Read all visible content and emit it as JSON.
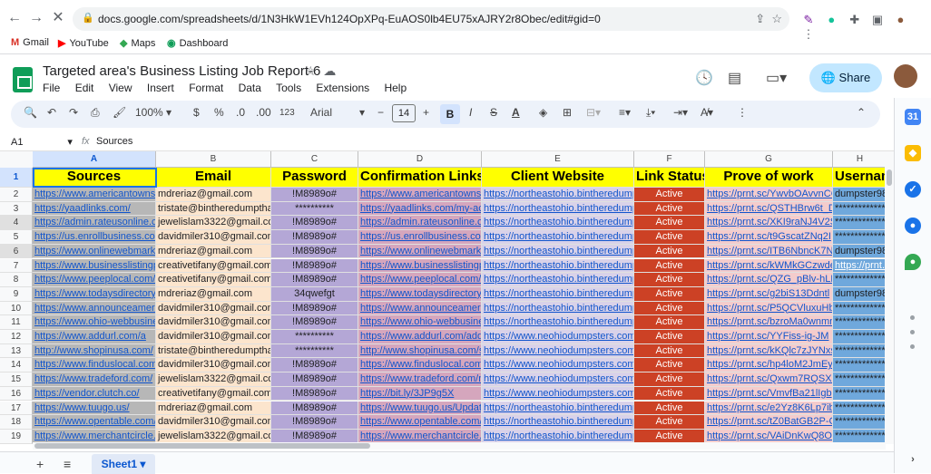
{
  "browser": {
    "url": "docs.google.com/spreadsheets/d/1N3HkW1EVh124OpXPq-EuAOS0lb4EU75xAJRY2r8Obec/edit#gid=0",
    "bookmarks": [
      {
        "label": "Gmail",
        "icon": "gmail-icon",
        "color": "#d93025"
      },
      {
        "label": "YouTube",
        "icon": "youtube-icon",
        "color": "#ff0000"
      },
      {
        "label": "Maps",
        "icon": "maps-icon",
        "color": "#34a853"
      },
      {
        "label": "Dashboard",
        "icon": "dashboard-icon",
        "color": "#0f9d58"
      }
    ]
  },
  "app": {
    "title": "Targeted area's Business Listing Job Report-6",
    "menus": [
      "File",
      "Edit",
      "View",
      "Insert",
      "Format",
      "Data",
      "Tools",
      "Extensions",
      "Help"
    ],
    "share_label": "Share"
  },
  "toolbar": {
    "zoom": "100%",
    "currency": "$",
    "percent": "%",
    "dec_decrease": ".0",
    "dec_increase": ".00",
    "number_format": "123",
    "font": "Arial",
    "font_size": "14",
    "bold": "B",
    "italic": "I",
    "strike": "S",
    "text_color": "A"
  },
  "formula": {
    "cell_ref": "A1",
    "fx": "fx",
    "content": "Sources"
  },
  "columns": [
    "A",
    "B",
    "C",
    "D",
    "E",
    "F",
    "G",
    "H"
  ],
  "headers": [
    "Sources",
    "Email",
    "Password",
    "Confirmation Links",
    "Client Website",
    "Link Status",
    "Prove of work",
    "Usernam"
  ],
  "rows": [
    [
      "https://www.americantowns.com",
      "mdreriaz@gmail.com",
      "!M8989o#",
      "https://www.americantowns.com",
      "https://northeastohio.bintheredumpthat.com",
      "Active",
      "https://prnt.sc/YwvbOAvvnCC",
      "dumpster98"
    ],
    [
      "https://yaadlinks.com/",
      "tristate@bintheredumpthat.com",
      "**********",
      "https://yaadlinks.com/my-account",
      "https://northeastohio.bintheredumpthat.com",
      "Active",
      "https://prnt.sc/QSTHBrw6t_De",
      "**************"
    ],
    [
      "https://admin.rateusonline.com",
      "jewelislam3322@gmail.com",
      "!M8989o#",
      "https://admin.rateusonline.com",
      "https://northeastohio.bintheredumpthat.com",
      "Active",
      "https://prnt.sc/XKI9raNJ4V2S",
      "**************"
    ],
    [
      "https://us.enrollbusiness.com/",
      "davidmiler310@gmail.com",
      "!M8989o#",
      "https://us.enrollbusiness.com/",
      "https://northeastohio.bintheredumpthat.com",
      "Active",
      "https://prnt.sc/t9GscatZNq2I",
      "**************"
    ],
    [
      "https://www.onlinewebmarks.com",
      "mdreriaz@gmail.com",
      "!M8989o#",
      "https://www.onlinewebmarks.com",
      "https://northeastohio.bintheredumpthat.com",
      "Active",
      "https://prnt.sc/ITB6NbncK7NA",
      "dumpster98"
    ],
    [
      "https://www.businesslistingplus.com",
      "creativetifany@gmail.com",
      "!M8989o#",
      "https://www.businesslistingplus.com",
      "https://northeastohio.bintheredumpthat.com",
      "Active",
      "https://prnt.sc/kWMkGCzwdeF",
      "https://prnt.sc"
    ],
    [
      "https://www.peeplocal.com/",
      "creativetifany@gmail.com",
      "!M8989o#",
      "https://www.peeplocal.com/account",
      "https://northeastohio.bintheredumpthat.com",
      "Active",
      "https://prnt.sc/QZG_pBlv-hLE",
      "**************"
    ],
    [
      "https://www.todaysdirectory.com",
      "mdreriaz@gmail.com",
      "34qwefgt",
      "https://www.todaysdirectory.com",
      "https://northeastohio.bintheredumpthat.com",
      "Active",
      "https://prnt.sc/g2biS13Ddntl",
      "dumpster98"
    ],
    [
      "https://www.announceamerica.com",
      "davidmiler310@gmail.com",
      "!M8989o#",
      "https://www.announceamerica.com",
      "https://northeastohio.bintheredumpthat.com",
      "Active",
      "https://prnt.sc/P5QCVluxuHbk",
      "**************"
    ],
    [
      "https://www.ohio-webbusiness.com",
      "davidmiler310@gmail.com",
      "!M8989o#",
      "https://www.ohio-webbusiness.com",
      "https://northeastohio.bintheredumpthat.com",
      "Active",
      "https://prnt.sc/bzroMa0wnmn1",
      "**************"
    ],
    [
      "https://www.addurl.com/a",
      "davidmiler310@gmail.com",
      "**********",
      "https://www.addurl.com/add-url",
      "https://www.neohiodumpsters.com/",
      "Active",
      "https://prnt.sc/YYFiss-ig-JM",
      "**************"
    ],
    [
      "http://www.shopinusa.com/",
      "tristate@bintheredumpthat.com",
      "**********",
      "http://www.shopinusa.com/signup",
      "https://www.neohiodumpsters.com/",
      "Active",
      "https://prnt.sc/kKQlc7zJYNxs",
      "**************"
    ],
    [
      "https://www.finduslocal.com/",
      "davidmiler310@gmail.com",
      "!M8989o#",
      "https://www.finduslocal.com/member",
      "https://www.neohiodumpsters.com/",
      "Active",
      "https://prnt.sc/hp4loM2JmEyx",
      "**************"
    ],
    [
      "https://www.tradeford.com/",
      "jewelislam3322@gmail.com",
      "!M8989o#",
      "https://www.tradeford.com/members",
      "https://www.neohiodumpsters.com/",
      "Active",
      "https://prnt.sc/Qxwm7RQSXrKi",
      "**************"
    ],
    [
      "https://vendor.clutch.co/",
      "creativetifany@gmail.com",
      "!M8989o#",
      "https://bit.ly/3JP9g5X",
      "https://www.neohiodumpsters.com/",
      "Active",
      "https://prnt.sc/VmvfBa21lIgb",
      "**************"
    ],
    [
      "https://www.tuugo.us/",
      "mdreriaz@gmail.com",
      "!M8989o#",
      "https://www.tuugo.us/UpdateCompany",
      "https://northeastohio.bintheredumpthat.com",
      "Active",
      "https://prnt.sc/e2Yz8K6Lp7ib",
      "**************"
    ],
    [
      "https://www.opentable.com/us",
      "davidmiler310@gmail.com",
      "!M8989o#",
      "https://www.opentable.com/us/restaurant",
      "https://northeastohio.bintheredumpthat.com",
      "Active",
      "https://prnt.sc/tZ0BatGB2P-C",
      "**************"
    ],
    [
      "https://www.merchantcircle.com",
      "jewelislam3322@gmail.com",
      "!M8989o#",
      "https://www.merchantcircle.com",
      "https://northeastohio.bintheredumpthat.com",
      "Active",
      "https://prnt.sc/VAiDnKwQ8OMe",
      "**************"
    ]
  ],
  "sheet": {
    "tab": "Sheet1",
    "add": "+",
    "all": "≡"
  },
  "colors": {
    "header_yellow": "#ffff00",
    "col_a": "#b7b7b7",
    "col_b": "#fce5cd",
    "col_c": "#b4a7d6",
    "col_d": "#d5a6bd",
    "col_e": "#d9d2e9",
    "col_f": "#cc4125",
    "col_g": "#f4cccc",
    "col_h": "#6fa8dc",
    "accent": "#1a73e8"
  }
}
